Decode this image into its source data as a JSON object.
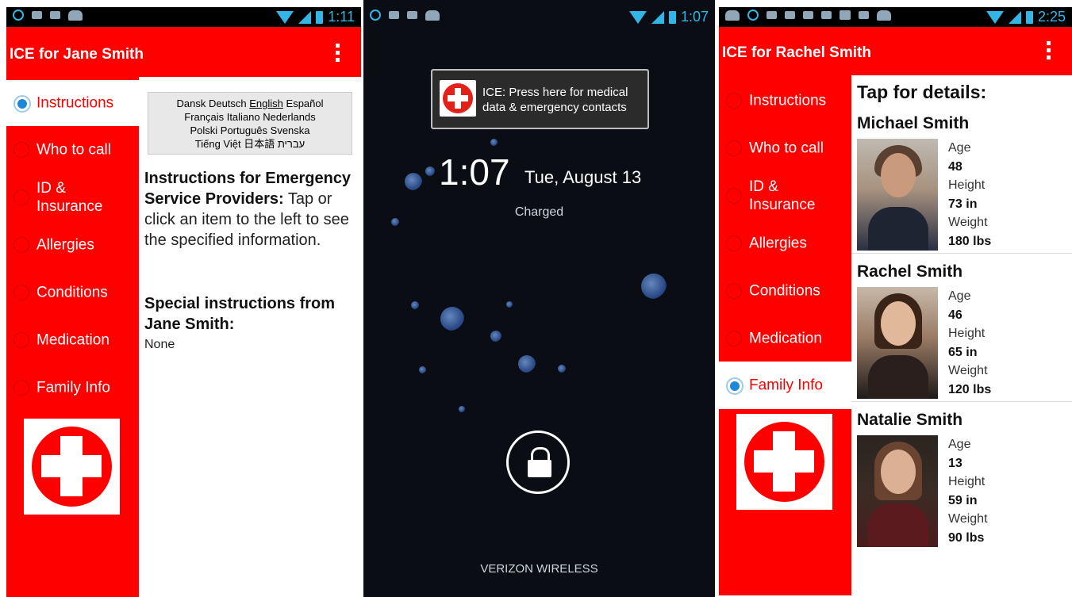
{
  "screen1": {
    "status": {
      "time": "1:11"
    },
    "appbar": {
      "title": "ICE for Jane Smith"
    },
    "nav": [
      {
        "label": "Instructions"
      },
      {
        "label": "Who to call"
      },
      {
        "label": "ID & Insurance"
      },
      {
        "label": "Allergies"
      },
      {
        "label": "Conditions"
      },
      {
        "label": "Medication"
      },
      {
        "label": "Family Info"
      }
    ],
    "languages": {
      "line1a": "Dansk Deutsch",
      "line1b": "English",
      "line1c": "Español",
      "line2": "Français Italiano Nederlands",
      "line3": "Polski Português Svenska",
      "line4": "Tiếng Việt 日本語 עברית"
    },
    "instructions": {
      "heading": "Instructions for Emergency Service Providers:",
      "body": "Tap or click an item to the left to see the specified information.",
      "special_heading": "Special instructions from Jane Smith:",
      "special_value": "None"
    }
  },
  "screen2": {
    "status": {
      "time": "1:07"
    },
    "notification": {
      "line1": "ICE: Press here for medical",
      "line2": "data & emergency contacts"
    },
    "time": "1:07",
    "date": "Tue, August 13",
    "charge_status": "Charged",
    "carrier": "VERIZON WIRELESS"
  },
  "screen3": {
    "status": {
      "time": "2:25"
    },
    "appbar": {
      "title": "ICE for Rachel Smith"
    },
    "nav": [
      {
        "label": "Instructions"
      },
      {
        "label": "Who to call"
      },
      {
        "label": "ID & Insurance"
      },
      {
        "label": "Allergies"
      },
      {
        "label": "Conditions"
      },
      {
        "label": "Medication"
      },
      {
        "label": "Family Info"
      }
    ],
    "tap_title": "Tap for details:",
    "people": [
      {
        "name": "Michael Smith",
        "age_label": "Age",
        "age": "48",
        "height_label": "Height",
        "height": "73 in",
        "weight_label": "Weight",
        "weight": "180 lbs"
      },
      {
        "name": "Rachel Smith",
        "age_label": "Age",
        "age": "46",
        "height_label": "Height",
        "height": "65 in",
        "weight_label": "Weight",
        "weight": "120 lbs"
      },
      {
        "name": "Natalie Smith",
        "age_label": "Age",
        "age": "13",
        "height_label": "Height",
        "height": "59 in",
        "weight_label": "Weight",
        "weight": "90 lbs"
      }
    ]
  },
  "colors": {
    "primary": "#ff0000",
    "accent": "#33b5e5",
    "selected_radio": "#1e88d6"
  }
}
